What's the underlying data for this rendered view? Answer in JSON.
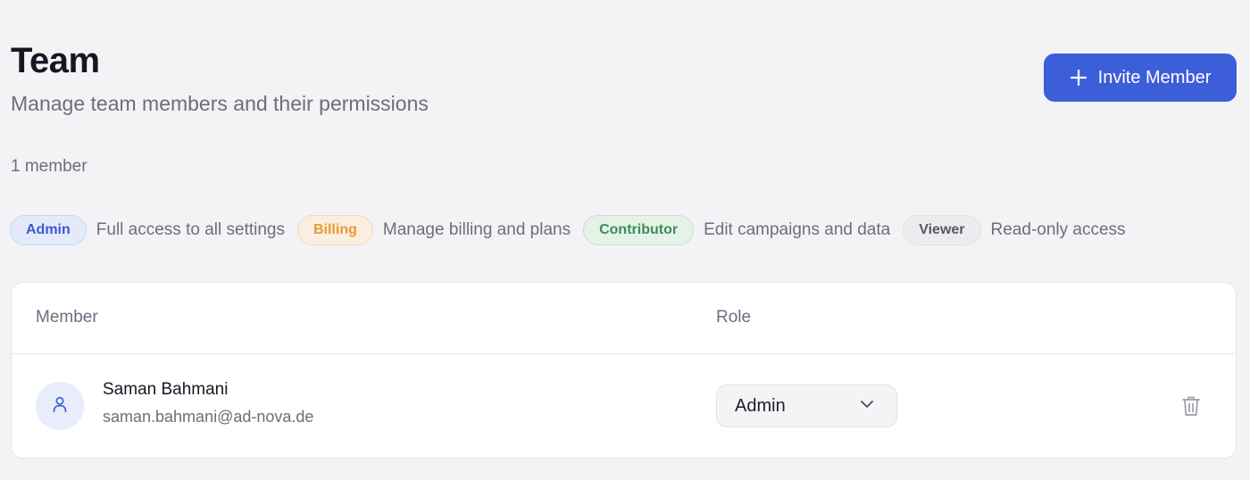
{
  "header": {
    "title": "Team",
    "subtitle": "Manage team members and their permissions",
    "invite_button_label": "Invite Member",
    "invite_icon": "plus-icon"
  },
  "member_count": "1 member",
  "roles_legend": [
    {
      "role": "Admin",
      "description": "Full access to all settings",
      "color": "#3c59cf"
    },
    {
      "role": "Billing",
      "description": "Manage billing and plans",
      "color": "#e89a35"
    },
    {
      "role": "Contributor",
      "description": "Edit campaigns and data",
      "color": "#3b8f55"
    },
    {
      "role": "Viewer",
      "description": "Read-only access",
      "color": "#555866"
    }
  ],
  "table": {
    "columns": [
      "Member",
      "Role"
    ],
    "rows": [
      {
        "name": "Saman Bahmani",
        "email": "saman.bahmani@ad-nova.de",
        "avatar_icon": "user-icon",
        "role": "Admin",
        "role_dropdown_icon": "chevron-down-icon",
        "delete_icon": "trash-icon"
      }
    ]
  },
  "colors": {
    "accent": "#3d5ed9",
    "background": "#f3f3f6"
  }
}
